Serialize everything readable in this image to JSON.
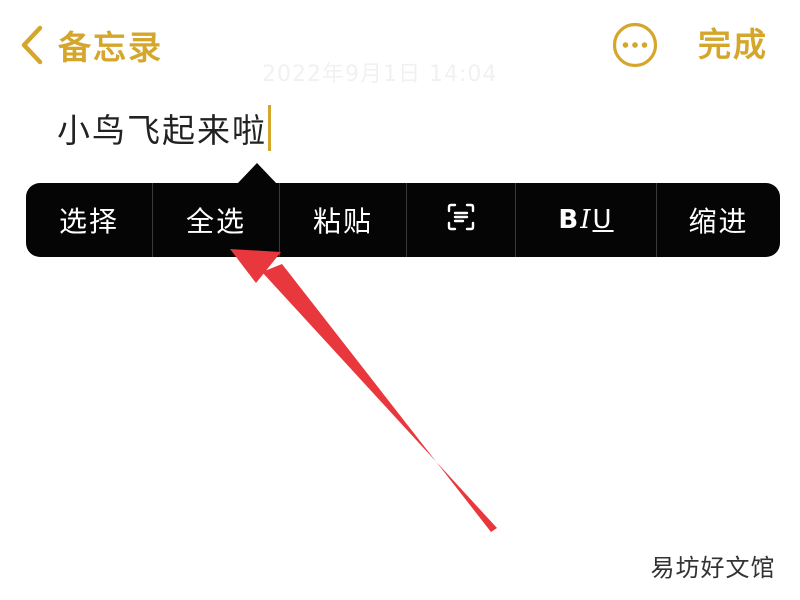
{
  "nav": {
    "back_label": "备忘录",
    "back_icon": "chevron-left-icon",
    "more_icon": "ellipsis-circle-icon",
    "done_label": "完成"
  },
  "note": {
    "date": "2022年9月1日 14:04",
    "text": "小鸟飞起来啦"
  },
  "edit_menu": {
    "items": [
      {
        "label": "选择"
      },
      {
        "label": "全选"
      },
      {
        "label": "粘贴"
      },
      {
        "label": "",
        "icon": "scan-text-icon"
      },
      {
        "label": "BIU",
        "parts": [
          "B",
          "I",
          "U"
        ]
      },
      {
        "label": "缩进"
      }
    ]
  },
  "annotation": {
    "arrow_color": "#e8383d",
    "target": "全选"
  },
  "watermark": {
    "text": "易坊好文馆"
  },
  "colors": {
    "accent": "#d4a72c",
    "menu_background": "#050505",
    "arrow": "#e8383d"
  }
}
